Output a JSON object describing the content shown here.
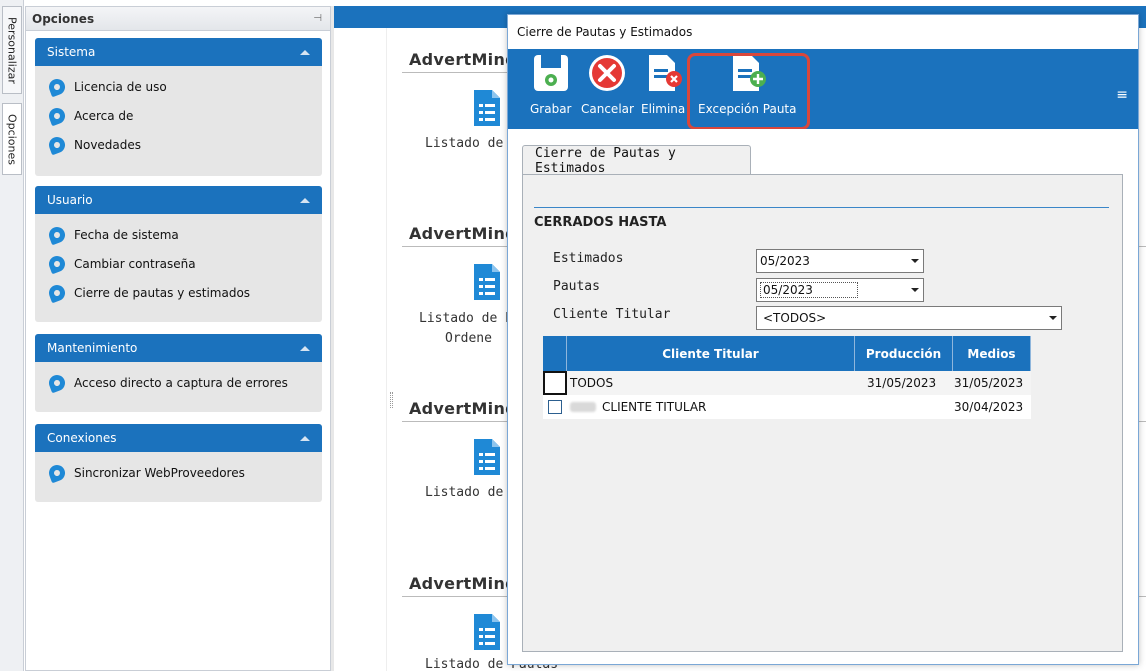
{
  "side_tabs": {
    "personalizar": "Personalizar",
    "opciones": "Opciones"
  },
  "options_panel": {
    "title": "Opciones",
    "groups": [
      {
        "title": "Sistema",
        "items": [
          "Licencia de uso",
          "Acerca de",
          "Novedades"
        ]
      },
      {
        "title": "Usuario",
        "items": [
          "Fecha de sistema",
          "Cambiar contraseña",
          "Cierre de pautas y estimados"
        ]
      },
      {
        "title": "Mantenimiento",
        "items": [
          "Acceso directo a captura de errores"
        ]
      },
      {
        "title": "Conexiones",
        "items": [
          "Sincronizar WebProveedores"
        ]
      }
    ]
  },
  "background": {
    "sections": [
      {
        "title": "AdvertMind",
        "listado": "Listado de P"
      },
      {
        "title": "AdvertMind",
        "listado": "Listado de P",
        "listado2": "Ordene"
      },
      {
        "title": "AdvertMind",
        "listado": "Listado de P"
      },
      {
        "title": "AdvertMind",
        "listado": "Listado de Pautas"
      }
    ]
  },
  "dialog": {
    "title": "Cierre de Pautas y Estimados",
    "toolbar": {
      "grabar": "Grabar",
      "cancelar": "Cancelar",
      "eliminar": "Elimina",
      "excepcion": "Excepción Pauta"
    },
    "tab": "Cierre de Pautas y Estimados",
    "section_title": "CERRADOS HASTA",
    "fields": {
      "estimados_label": "Estimados",
      "estimados_value": "05/2023",
      "pautas_label": "Pautas",
      "pautas_value": "05/2023",
      "cliente_label": "Cliente Titular",
      "cliente_value": "<TODOS>"
    },
    "grid": {
      "columns": [
        "Cliente Titular",
        "Producción",
        "Medios"
      ],
      "rows": [
        {
          "cliente": "TODOS",
          "produccion": "31/05/2023",
          "medios": "31/05/2023"
        },
        {
          "cliente": "CLIENTE TITULAR",
          "produccion": "",
          "medios": "30/04/2023"
        }
      ]
    }
  },
  "colors": {
    "accent": "#1b72bd",
    "highlight": "#d9473b",
    "panel_bg": "#f0f0f0"
  }
}
